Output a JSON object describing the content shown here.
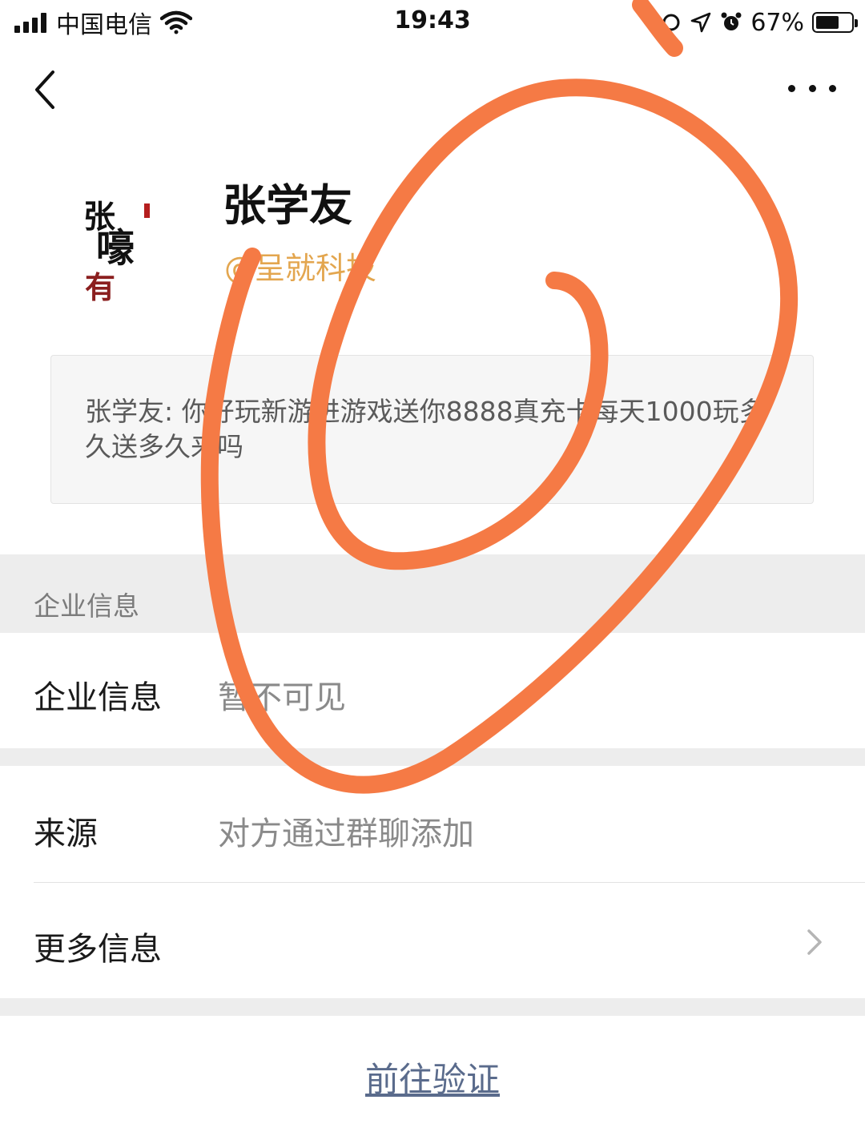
{
  "status_bar": {
    "carrier": "中国电信",
    "time": "19:43",
    "battery_percent": "67%",
    "battery_level": 0.67
  },
  "nav": {
    "back_icon": "chevron-left-icon",
    "more_icon": "more-dots-icon"
  },
  "profile": {
    "name": "张学友",
    "company": "@呈就科技",
    "avatar_chars": [
      "张",
      "嚎",
      "有"
    ]
  },
  "message": {
    "text": "张学友: 你好玩新游进游戏送你8888真充卡每天1000玩多久送多久来吗"
  },
  "section": {
    "title": "企业信息"
  },
  "rows": {
    "enterprise": {
      "label": "企业信息",
      "value": "暂不可见"
    },
    "source": {
      "label": "来源",
      "value": "对方通过群聊添加"
    },
    "more": {
      "label": "更多信息"
    }
  },
  "actions": {
    "verify": "前往验证"
  },
  "colors": {
    "company": "#e3a64f",
    "scribble": "#f57a45",
    "link": "#5a6b8c",
    "section_bg": "#ededed"
  }
}
